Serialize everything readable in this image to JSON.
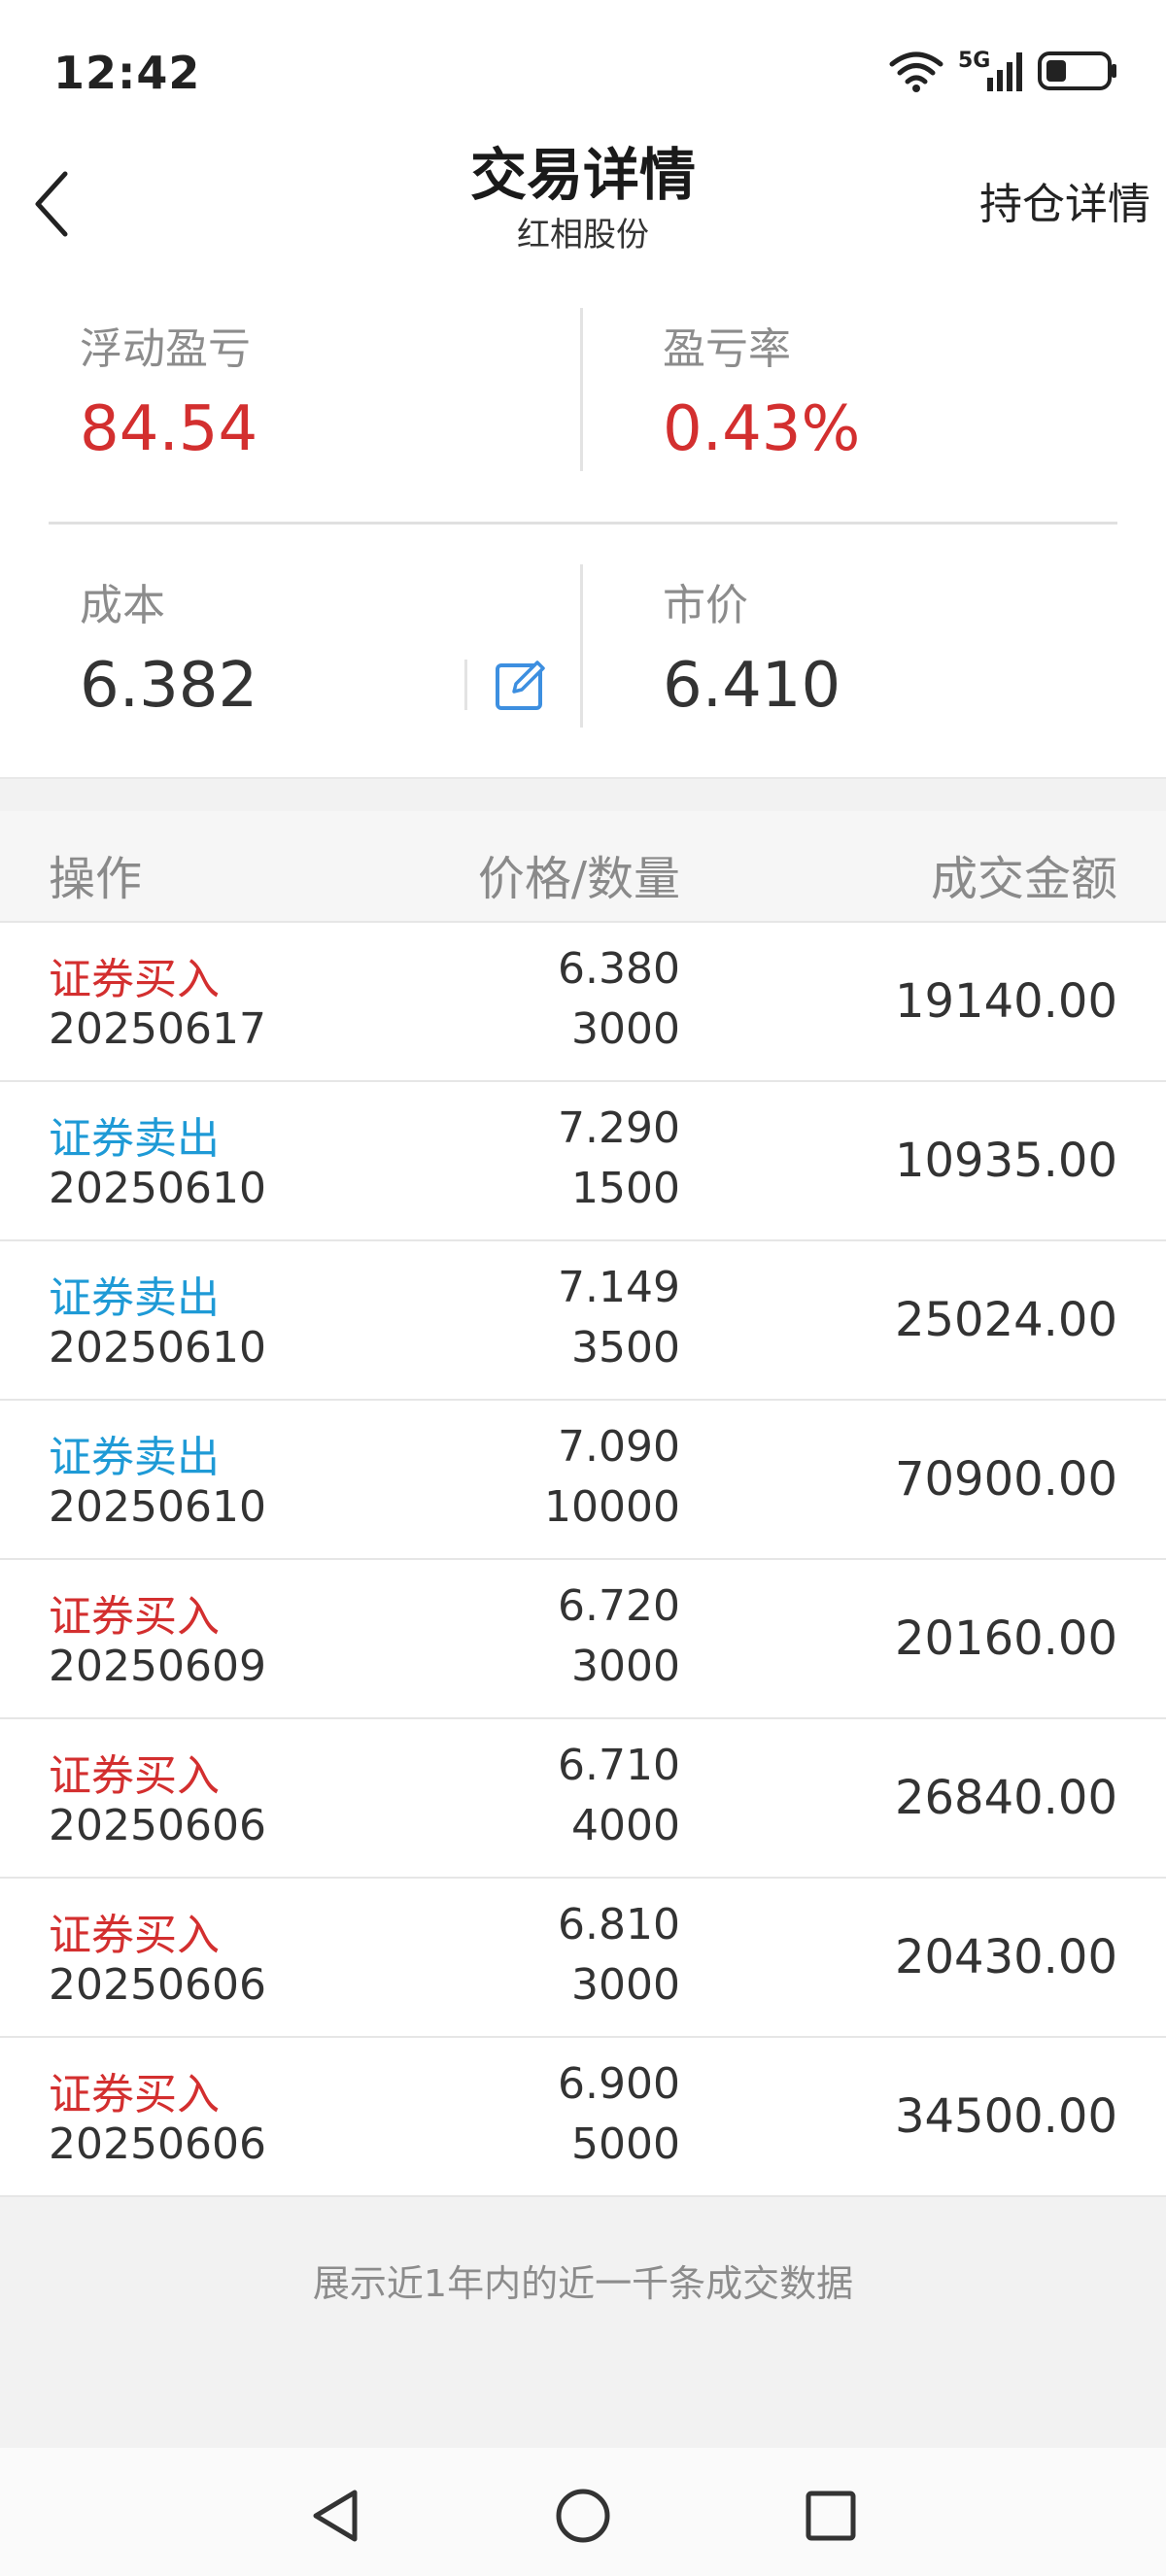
{
  "status_bar": {
    "time": "12:42",
    "network_label": "5G",
    "icons": [
      "wifi-icon",
      "signal-icon",
      "battery-icon"
    ]
  },
  "header": {
    "title": "交易详情",
    "subtitle": "红相股份",
    "right_link": "持仓详情"
  },
  "summary": {
    "floating_pnl_label": "浮动盈亏",
    "floating_pnl_value": "84.54",
    "pnl_rate_label": "盈亏率",
    "pnl_rate_value": "0.43%",
    "cost_label": "成本",
    "cost_value": "6.382",
    "market_price_label": "市价",
    "market_price_value": "6.410"
  },
  "table": {
    "columns": [
      "操作",
      "价格/数量",
      "成交金额"
    ],
    "rows": [
      {
        "op": "证券买入",
        "type": "buy",
        "date": "20250617",
        "price": "6.380",
        "qty": "3000",
        "amount": "19140.00"
      },
      {
        "op": "证券卖出",
        "type": "sell",
        "date": "20250610",
        "price": "7.290",
        "qty": "1500",
        "amount": "10935.00"
      },
      {
        "op": "证券卖出",
        "type": "sell",
        "date": "20250610",
        "price": "7.149",
        "qty": "3500",
        "amount": "25024.00"
      },
      {
        "op": "证券卖出",
        "type": "sell",
        "date": "20250610",
        "price": "7.090",
        "qty": "10000",
        "amount": "70900.00"
      },
      {
        "op": "证券买入",
        "type": "buy",
        "date": "20250609",
        "price": "6.720",
        "qty": "3000",
        "amount": "20160.00"
      },
      {
        "op": "证券买入",
        "type": "buy",
        "date": "20250606",
        "price": "6.710",
        "qty": "4000",
        "amount": "26840.00"
      },
      {
        "op": "证券买入",
        "type": "buy",
        "date": "20250606",
        "price": "6.810",
        "qty": "3000",
        "amount": "20430.00"
      },
      {
        "op": "证券买入",
        "type": "buy",
        "date": "20250606",
        "price": "6.900",
        "qty": "5000",
        "amount": "34500.00"
      }
    ]
  },
  "footer_note": "展示近1年内的近一千条成交数据",
  "colors": {
    "buy": "#d32f2f",
    "sell": "#1e9ad6",
    "profit": "#d32f2f"
  }
}
